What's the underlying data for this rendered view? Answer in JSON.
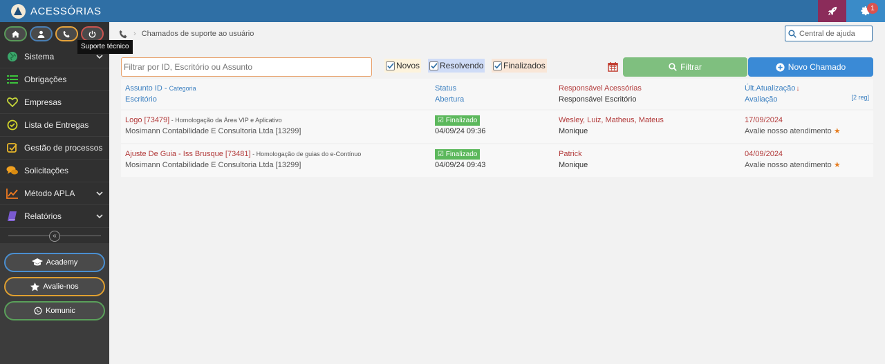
{
  "app": {
    "title": "ACESSÓRIAS",
    "notification_count": "1"
  },
  "sidebar": {
    "tooltip": "Suporte técnico",
    "menu": [
      {
        "label": "Sistema",
        "icon": "globe-icon",
        "has_chevron": true
      },
      {
        "label": "Obrigações",
        "icon": "list-icon",
        "has_chevron": false
      },
      {
        "label": "Empresas",
        "icon": "heart-icon",
        "has_chevron": false
      },
      {
        "label": "Lista de Entregas",
        "icon": "check-circle-icon",
        "has_chevron": false
      },
      {
        "label": "Gestão de processos",
        "icon": "check-square-icon",
        "has_chevron": false
      },
      {
        "label": "Solicitações",
        "icon": "comments-icon",
        "has_chevron": false
      },
      {
        "label": "Método APLA",
        "icon": "line-chart-icon",
        "has_chevron": true
      },
      {
        "label": "Relatórios",
        "icon": "book-icon",
        "has_chevron": true
      }
    ],
    "buttons": {
      "academy": "Academy",
      "avalie": "Avalie-nos",
      "komunic": "Komunic"
    }
  },
  "breadcrumb": {
    "label": "Chamados de suporte ao usuário"
  },
  "help": {
    "placeholder": "Central de ajuda"
  },
  "filters": {
    "search_placeholder": "Filtrar por ID, Escritório ou Assunto",
    "checkboxes": {
      "novos": "Novos",
      "resolvendo": "Resolvendo",
      "finalizados": "Finalizados"
    },
    "filter_button": "Filtrar",
    "new_button": "Novo Chamado"
  },
  "table": {
    "headers": {
      "subject": "Assunto ID -",
      "category": "Categoria",
      "office": "Escritório",
      "status": "Status",
      "opened": "Abertura",
      "responsible": "Responsável Acessórias",
      "responsible_office": "Responsável Escritório",
      "last_update": "Últ.Atualização",
      "rating": "Avaliação",
      "count": "[2 reg]"
    },
    "rows": [
      {
        "subject": "Logo [73479]",
        "category": " - Homologação da Área VIP e Aplicativo",
        "office": "Mosimann Contabilidade E Consultoria Ltda [13299]",
        "status": "Finalizado",
        "opened": "04/09/24 09:36",
        "responsible": "Wesley, Luiz, Matheus, Mateus",
        "responsible_office": "Monique",
        "last_update": "17/09/2024",
        "rating": "Avalie nosso atendimento"
      },
      {
        "subject": "Ajuste De Guia - Iss Brusque [73481]",
        "category": " - Homologação de guias do e-Contínuo",
        "office": "Mosimann Contabilidade E Consultoria Ltda [13299]",
        "status": "Finalizado",
        "opened": "04/09/24 09:43",
        "responsible": "Patrick",
        "responsible_office": "Monique",
        "last_update": "04/09/2024",
        "rating": "Avalie nosso atendimento"
      }
    ]
  }
}
